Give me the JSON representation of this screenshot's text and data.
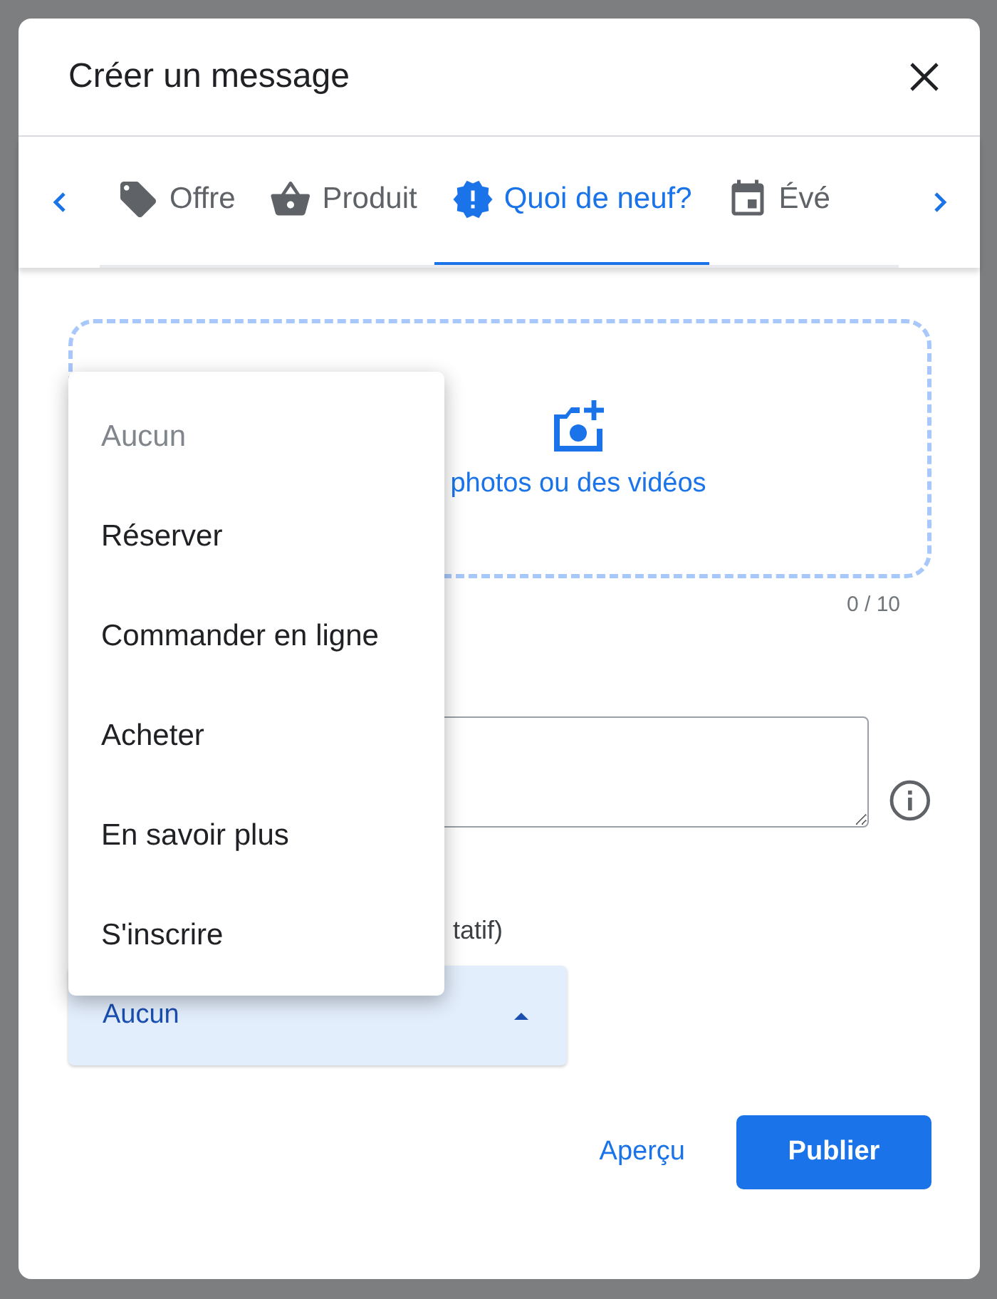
{
  "dialog": {
    "title": "Créer un message",
    "tabs": [
      {
        "label": "Offre",
        "selected": false
      },
      {
        "label": "Produit",
        "selected": false
      },
      {
        "label": "Quoi de neuf?",
        "selected": true
      },
      {
        "label": "Évé",
        "selected": false
      }
    ],
    "upload": {
      "label": "photos ou des vidéos",
      "counter": "0 / 10"
    },
    "button_label": "tatif)",
    "select": {
      "value": "Aucun",
      "expanded": true
    },
    "menu": [
      {
        "label": "Aucun",
        "disabled": true
      },
      {
        "label": "Réserver",
        "disabled": false
      },
      {
        "label": "Commander en ligne",
        "disabled": false
      },
      {
        "label": "Acheter",
        "disabled": false
      },
      {
        "label": "En savoir plus",
        "disabled": false
      },
      {
        "label": "S'inscrire",
        "disabled": false
      }
    ],
    "actions": {
      "preview": "Aperçu",
      "publish": "Publier"
    }
  }
}
